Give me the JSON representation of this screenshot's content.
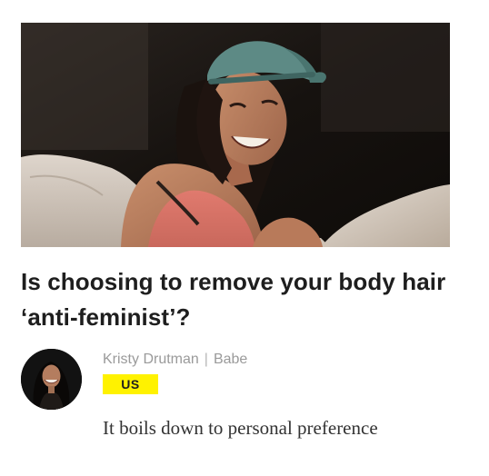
{
  "article": {
    "image": {
      "description_icon": "hero-photo"
    },
    "title": "Is choosing to remove your body hair ‘anti-feminist’?",
    "author": "Kristy Drutman",
    "separator": "|",
    "publication": "Babe",
    "tag": "US",
    "subtitle": "It boils down to personal preference"
  },
  "colors": {
    "badge": "#fff200",
    "title": "#1e1e1e",
    "byline": "#9a9a9a",
    "subtitle": "#333333"
  }
}
